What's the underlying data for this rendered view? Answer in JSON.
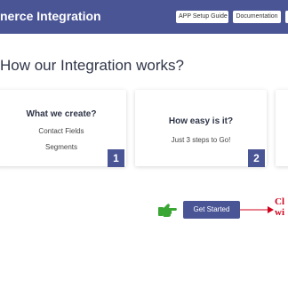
{
  "header": {
    "title": "nerce Integration",
    "buttons": [
      "APP Setup Guide",
      "Documentation"
    ]
  },
  "section": {
    "title": "How our Integration works?"
  },
  "cards": [
    {
      "title": "What we create?",
      "lines": [
        "Contact Fields",
        "Segments"
      ],
      "badge": "1"
    },
    {
      "title": "How easy is it?",
      "lines": [
        "Just 3 steps to Go!"
      ],
      "badge": "2"
    }
  ],
  "cta": {
    "label": "Get Started",
    "callout": [
      "Cl",
      "wi"
    ],
    "hand_icon": "pointing-hand-icon",
    "arrow_icon": "right-arrow-icon"
  },
  "colors": {
    "primary": "#4a5596",
    "callout": "#d0021b",
    "hand": "#3aa634"
  }
}
